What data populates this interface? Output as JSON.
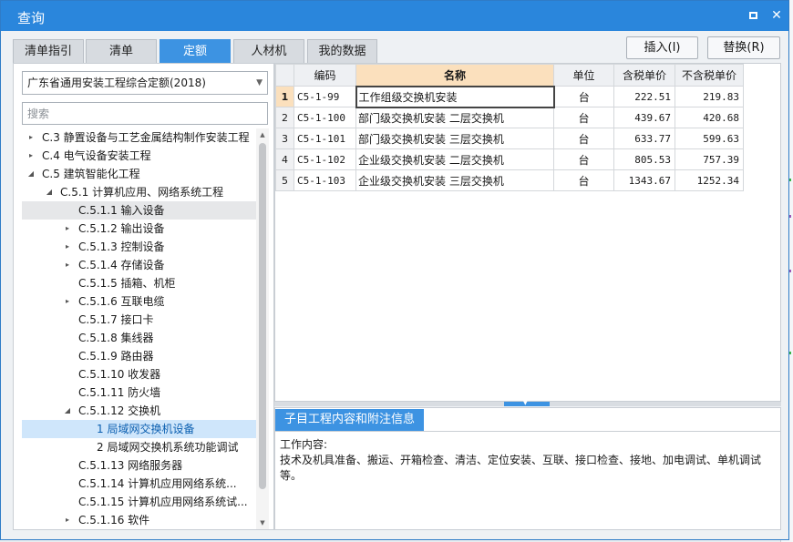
{
  "window": {
    "title": "查询",
    "maximize_label": "□",
    "close_label": "✕"
  },
  "tabs": [
    {
      "label": "清单指引"
    },
    {
      "label": "清单"
    },
    {
      "label": "定额"
    },
    {
      "label": "人材机"
    },
    {
      "label": "我的数据"
    }
  ],
  "actions": {
    "insert_label": "插入(I)",
    "replace_label": "替换(R)"
  },
  "left": {
    "quota_selected": "广东省通用安装工程综合定额(2018)",
    "search_placeholder": "搜索",
    "tree": [
      {
        "label": "C.3 静置设备与工艺金属结构制作安装工程",
        "expander": "▸"
      },
      {
        "label": "C.4 电气设备安装工程",
        "expander": "▸"
      },
      {
        "label": "C.5 建筑智能化工程",
        "expander": "◢"
      },
      {
        "label": "C.5.1 计算机应用、网络系统工程",
        "expander": "◢"
      },
      {
        "label": "C.5.1.1 输入设备",
        "expander": ""
      },
      {
        "label": "C.5.1.2 输出设备",
        "expander": "▸"
      },
      {
        "label": "C.5.1.3 控制设备",
        "expander": "▸"
      },
      {
        "label": "C.5.1.4 存储设备",
        "expander": "▸"
      },
      {
        "label": "C.5.1.5 插箱、机柜",
        "expander": ""
      },
      {
        "label": "C.5.1.6 互联电缆",
        "expander": "▸"
      },
      {
        "label": "C.5.1.7 接口卡",
        "expander": ""
      },
      {
        "label": "C.5.1.8 集线器",
        "expander": ""
      },
      {
        "label": "C.5.1.9 路由器",
        "expander": ""
      },
      {
        "label": "C.5.1.10 收发器",
        "expander": ""
      },
      {
        "label": "C.5.1.11 防火墙",
        "expander": ""
      },
      {
        "label": "C.5.1.12 交换机",
        "expander": "◢"
      },
      {
        "label": "1 局域网交换机设备",
        "expander": ""
      },
      {
        "label": "2 局域网交换机系统功能调试",
        "expander": ""
      },
      {
        "label": "C.5.1.13 网络服务器",
        "expander": ""
      },
      {
        "label": "C.5.1.14 计算机应用网络系统...",
        "expander": ""
      },
      {
        "label": "C.5.1.15 计算机应用网络系统试...",
        "expander": ""
      },
      {
        "label": "C.5.1.16 软件",
        "expander": "▸"
      }
    ]
  },
  "grid": {
    "headers": [
      "编码",
      "名称",
      "单位",
      "含税单价",
      "不含税单价"
    ],
    "rows": [
      {
        "no": "1",
        "code": "C5-1-99",
        "name": "工作组级交换机安装",
        "unit": "台",
        "price_tax": "222.51",
        "price_notax": "219.83"
      },
      {
        "no": "2",
        "code": "C5-1-100",
        "name": "部门级交换机安装 二层交换机",
        "unit": "台",
        "price_tax": "439.67",
        "price_notax": "420.68"
      },
      {
        "no": "3",
        "code": "C5-1-101",
        "name": "部门级交换机安装 三层交换机",
        "unit": "台",
        "price_tax": "633.77",
        "price_notax": "599.63"
      },
      {
        "no": "4",
        "code": "C5-1-102",
        "name": "企业级交换机安装 二层交换机",
        "unit": "台",
        "price_tax": "805.53",
        "price_notax": "757.39"
      },
      {
        "no": "5",
        "code": "C5-1-103",
        "name": "企业级交换机安装 三层交换机",
        "unit": "台",
        "price_tax": "1343.67",
        "price_notax": "1252.34"
      }
    ]
  },
  "info": {
    "tab_label": "子目工程内容和附注信息",
    "heading": "工作内容:",
    "content": "技术及机具准备、搬运、开箱检查、清洁、定位安装、互联、接口检查、接地、加电调试、单机调试等。"
  },
  "colors": {
    "titlebar": "#2a86dc",
    "active_tab": "#3d93e2",
    "header_highlight": "#fbe0bd",
    "tree_selected": "#cfe6fb"
  }
}
